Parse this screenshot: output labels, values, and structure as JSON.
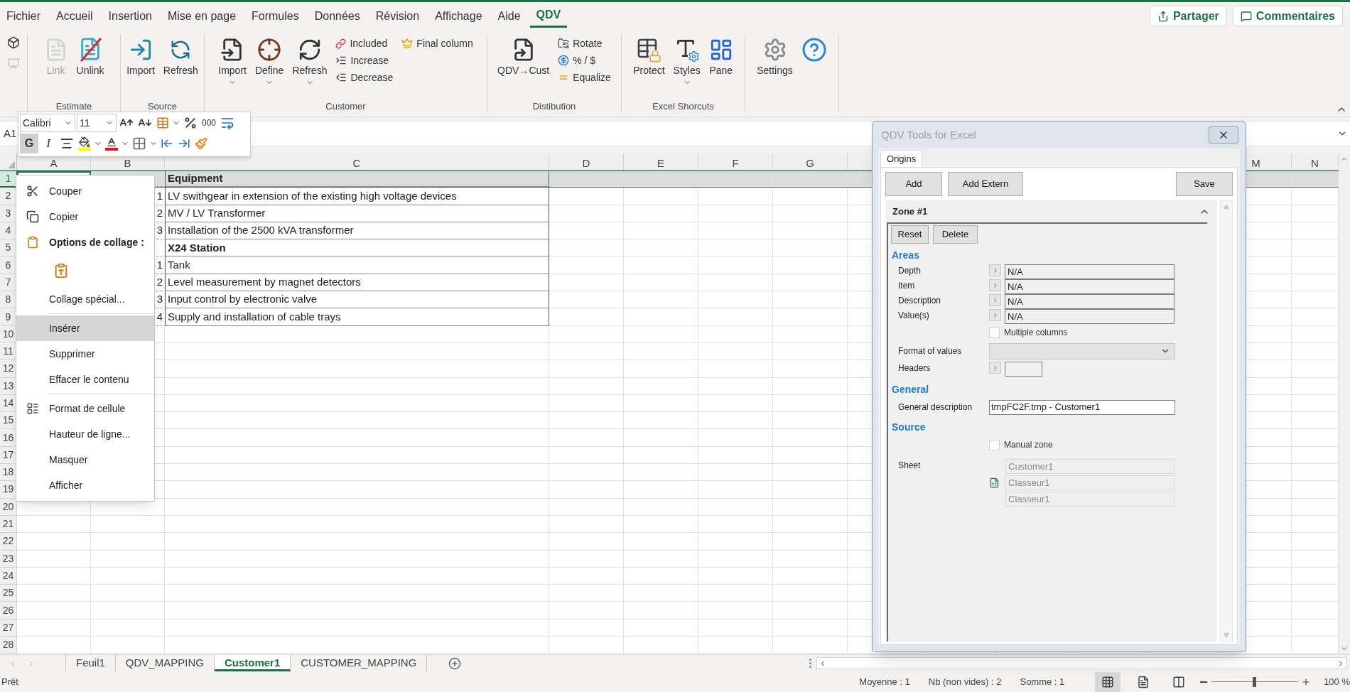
{
  "menu_tabs": [
    {
      "label": "Fichier",
      "selected": false
    },
    {
      "label": "Accueil",
      "selected": false
    },
    {
      "label": "Insertion",
      "selected": false
    },
    {
      "label": "Mise en page",
      "selected": false
    },
    {
      "label": "Formules",
      "selected": false
    },
    {
      "label": "Données",
      "selected": false
    },
    {
      "label": "Révision",
      "selected": false
    },
    {
      "label": "Affichage",
      "selected": false
    },
    {
      "label": "Aide",
      "selected": false
    },
    {
      "label": "QDV",
      "selected": true
    }
  ],
  "header_buttons": [
    "Partager",
    "Commentaires"
  ],
  "ribbon": {
    "groups": [
      {
        "items": [
          {
            "kind": "tiny",
            "disabled": false
          },
          {
            "kind": "tiny",
            "disabled": true
          }
        ]
      },
      {
        "label": "Estimate",
        "items": [
          {
            "kind": "large",
            "label": "Link",
            "disabled": true,
            "dropdown": false
          },
          {
            "kind": "large",
            "label": "Unlink",
            "disabled": false,
            "dropdown": false
          }
        ]
      },
      {
        "label": "Source",
        "items": [
          {
            "kind": "large",
            "label": "Import",
            "disabled": false,
            "dropdown": false
          },
          {
            "kind": "large",
            "label": "Refresh",
            "disabled": false,
            "dropdown": false
          }
        ]
      },
      {
        "label": "Customer",
        "items": [
          {
            "kind": "large",
            "label": "Import",
            "disabled": false,
            "dropdown": true
          },
          {
            "kind": "large",
            "label": "Define",
            "disabled": false,
            "dropdown": true
          },
          {
            "kind": "large",
            "label": "Refresh",
            "disabled": false,
            "dropdown": true
          },
          {
            "kind": "stack",
            "items": [
              "Included",
              "Increase",
              "Decrease"
            ]
          },
          {
            "kind": "stack",
            "items": [
              "Final column"
            ]
          }
        ]
      },
      {
        "label": "Distibution",
        "items": [
          {
            "kind": "large",
            "label": "QDV→Cust",
            "disabled": false,
            "dropdown": false
          },
          {
            "kind": "stack",
            "items": [
              "Rotate",
              "% / $",
              "Equalize"
            ]
          }
        ]
      },
      {
        "label": "Excel Shorcuts",
        "items": [
          {
            "kind": "large",
            "label": "Protect",
            "disabled": false,
            "dropdown": false
          },
          {
            "kind": "large",
            "label": "Styles",
            "disabled": false,
            "dropdown": true
          },
          {
            "kind": "large",
            "label": "Pane",
            "disabled": false,
            "dropdown": false
          }
        ]
      },
      {
        "items": [
          {
            "kind": "large",
            "label": "Settings",
            "disabled": false,
            "dropdown": false
          },
          {
            "kind": "large",
            "disabled": false,
            "dropdown": false
          }
        ]
      }
    ]
  },
  "formula_bar": {
    "name_box": "A1"
  },
  "mini_toolbar": {
    "font": "Calibri",
    "size": "11",
    "thousands": "000",
    "bold": {
      "label": "G",
      "pressed": true
    },
    "italic": "I"
  },
  "sheet": {
    "columns": [
      "A",
      "B",
      "C",
      "D",
      "E",
      "F",
      "G",
      "M",
      "N"
    ],
    "rows": [
      {
        "number": "1",
        "selected": true,
        "kind": "header",
        "description": "Equipment"
      },
      {
        "number": "2",
        "selected": false,
        "kind": "line",
        "item": "1",
        "description": "LV swithgear in extension of the existing high voltage devices"
      },
      {
        "number": "3",
        "selected": false,
        "kind": "line",
        "item": "2",
        "description": "MV / LV Transformer"
      },
      {
        "number": "4",
        "selected": false,
        "kind": "line",
        "item": "3",
        "description": "Installation of the 2500 kVA transformer"
      },
      {
        "number": "5",
        "selected": false,
        "kind": "group",
        "description": "X24 Station"
      },
      {
        "number": "6",
        "selected": false,
        "kind": "line",
        "item": "1",
        "description": "Tank"
      },
      {
        "number": "7",
        "selected": false,
        "kind": "line",
        "item": "2",
        "description": "Level measurement by magnet detectors"
      },
      {
        "number": "8",
        "selected": false,
        "kind": "line",
        "item": "3",
        "description": "Input control by electronic valve"
      },
      {
        "number": "9",
        "selected": false,
        "kind": "line",
        "item": "4",
        "description": "Supply and installation of cable trays"
      },
      {
        "number": "10",
        "selected": false,
        "kind": "empty"
      },
      {
        "number": "11",
        "selected": false,
        "kind": "empty"
      },
      {
        "number": "12",
        "selected": false,
        "kind": "empty"
      },
      {
        "number": "13",
        "selected": false,
        "kind": "empty"
      },
      {
        "number": "14",
        "selected": false,
        "kind": "empty"
      },
      {
        "number": "15",
        "selected": false,
        "kind": "empty"
      },
      {
        "number": "16",
        "selected": false,
        "kind": "empty"
      },
      {
        "number": "17",
        "selected": false,
        "kind": "empty"
      },
      {
        "number": "18",
        "selected": false,
        "kind": "empty"
      },
      {
        "number": "19",
        "selected": false,
        "kind": "empty"
      },
      {
        "number": "20",
        "selected": false,
        "kind": "empty"
      },
      {
        "number": "21",
        "selected": false,
        "kind": "empty"
      },
      {
        "number": "22",
        "selected": false,
        "kind": "empty"
      },
      {
        "number": "23",
        "selected": false,
        "kind": "empty"
      },
      {
        "number": "24",
        "selected": false,
        "kind": "empty"
      },
      {
        "number": "25",
        "selected": false,
        "kind": "empty"
      },
      {
        "number": "26",
        "selected": false,
        "kind": "empty"
      },
      {
        "number": "27",
        "selected": false,
        "kind": "empty"
      },
      {
        "number": "28",
        "selected": false,
        "kind": "empty"
      }
    ]
  },
  "context_menu": {
    "items": [
      {
        "kind": "item",
        "label": "Couper",
        "selected": false
      },
      {
        "kind": "item",
        "label": "Copier",
        "selected": false
      },
      {
        "kind": "heading",
        "label": "Options de collage :"
      },
      {
        "kind": "paste_option"
      },
      {
        "kind": "item",
        "label": "Collage spécial...",
        "selected": false
      },
      {
        "kind": "separator"
      },
      {
        "kind": "item",
        "label": "Insérer",
        "selected": true
      },
      {
        "kind": "item",
        "label": "Supprimer",
        "selected": false
      },
      {
        "kind": "item",
        "label": "Effacer le contenu",
        "selected": false
      },
      {
        "kind": "separator"
      },
      {
        "kind": "item",
        "label": "Format de cellule",
        "selected": false
      },
      {
        "kind": "item",
        "label": "Hauteur de ligne...",
        "selected": false
      },
      {
        "kind": "item",
        "label": "Masquer",
        "selected": false
      },
      {
        "kind": "item",
        "label": "Afficher",
        "selected": false
      }
    ]
  },
  "dialog": {
    "title": "QDV Tools for Excel",
    "tabs": [
      {
        "label": "Origins",
        "selected": true
      }
    ],
    "buttons": [
      "Add",
      "Add Extern",
      "Save"
    ],
    "zone": {
      "title": "Zone #1",
      "expanded": true,
      "buttons": [
        "Reset",
        "Delete"
      ],
      "sections": [
        {
          "heading": "Areas",
          "fields": [
            {
              "kind": "range",
              "label": "Depth",
              "value": "N/A"
            },
            {
              "kind": "range",
              "label": "Item",
              "value": "N/A"
            },
            {
              "kind": "range",
              "label": "Description",
              "value": "N/A"
            },
            {
              "kind": "range",
              "label": "Value(s)",
              "value": "N/A"
            },
            {
              "kind": "checkbox",
              "label": "Multiple columns",
              "checked": false
            },
            {
              "kind": "dropdown",
              "label": "Format of values"
            },
            {
              "kind": "short_range",
              "label": "Headers"
            }
          ]
        },
        {
          "heading": "General",
          "fields": [
            {
              "kind": "text",
              "label": "General description",
              "value": "tmpFC2F.tmp - Customer1"
            }
          ]
        },
        {
          "heading": "Source",
          "fields": [
            {
              "kind": "checkbox",
              "label": "Manual zone",
              "checked": false
            },
            {
              "kind": "sheet",
              "label": "Sheet",
              "values": [
                "Customer1",
                "Classeur1",
                "Classeur1"
              ]
            }
          ]
        }
      ]
    }
  },
  "sheet_tabs": [
    {
      "label": "Feuil1",
      "selected": false
    },
    {
      "label": "QDV_MAPPING",
      "selected": false
    },
    {
      "label": "Customer1",
      "selected": true
    },
    {
      "label": "CUSTOMER_MAPPING",
      "selected": false
    }
  ],
  "status_bar": {
    "ready": "Prêt",
    "stats": [
      "Moyenne : 1",
      "Nb (non vides) : 2",
      "Somme : 1"
    ],
    "views": [
      {
        "selected": true
      },
      {
        "selected": false
      },
      {
        "selected": false
      }
    ],
    "zoom": {
      "level": 0.49,
      "reading": "100 %"
    }
  }
}
